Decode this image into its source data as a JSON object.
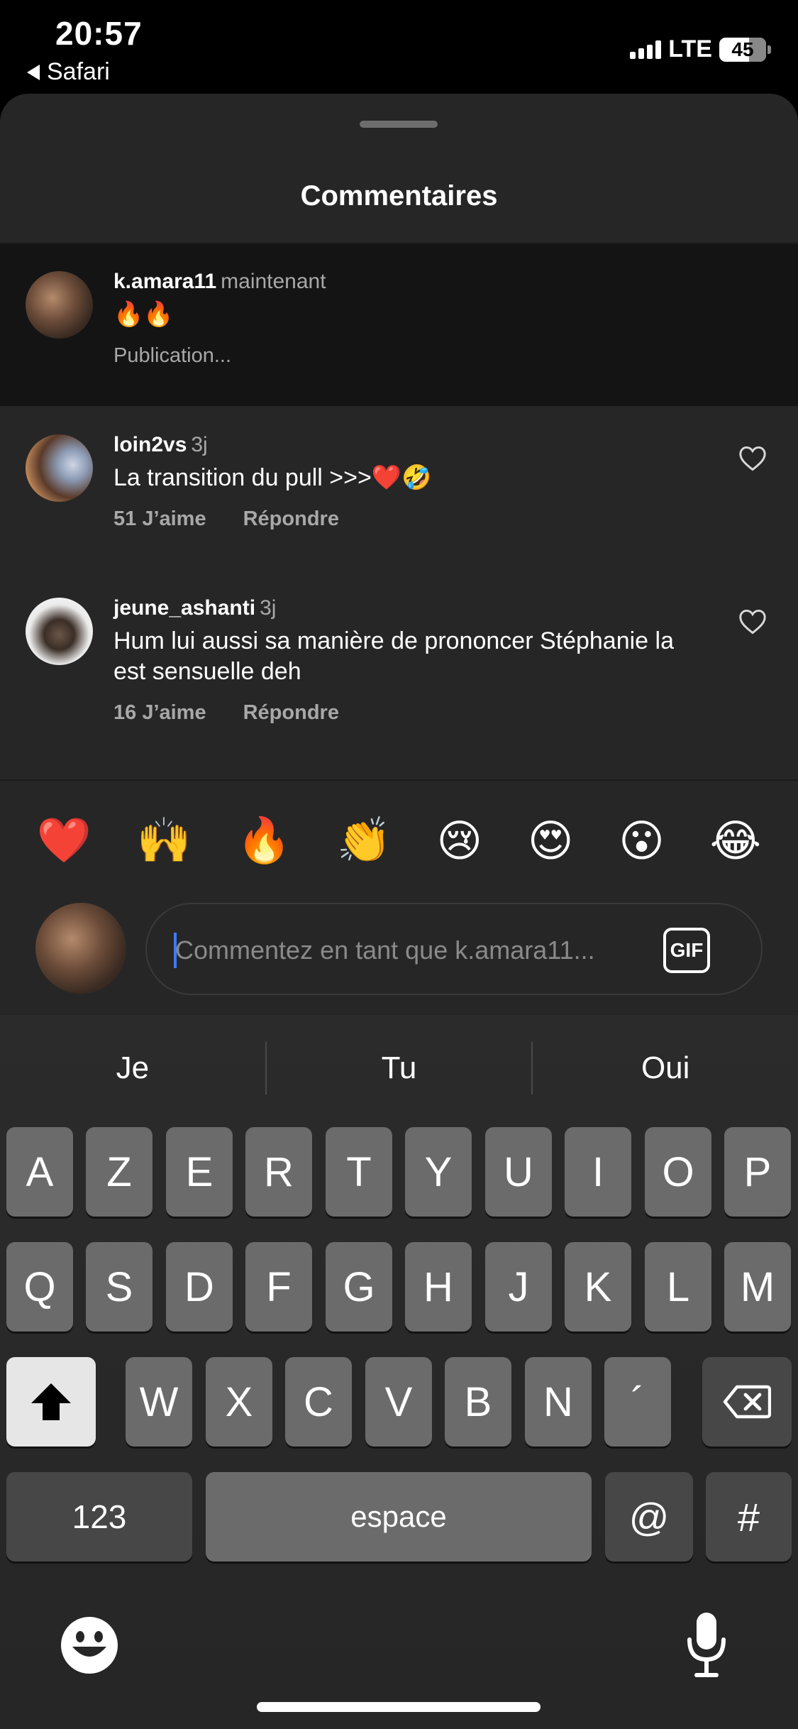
{
  "status": {
    "time": "20:57",
    "back_app": "Safari",
    "network": "LTE",
    "battery": "45"
  },
  "sheet": {
    "title": "Commentaires"
  },
  "comments": [
    {
      "user": "k.amara11",
      "time": "maintenant",
      "text": "🔥🔥",
      "status": "Publication..."
    },
    {
      "user": "loin2vs",
      "time": "3j",
      "text": "La transition du pull >>>❤️🤣",
      "likes": "51 J’aime",
      "reply": "Répondre"
    },
    {
      "user": "jeune_ashanti",
      "time": "3j",
      "text": "Hum lui aussi sa manière de prononcer Stéphanie la est sensuelle deh",
      "likes": "16 J’aime",
      "reply": "Répondre"
    }
  ],
  "quick_emojis": [
    "❤️",
    "🙌",
    "🔥",
    "👏",
    "😢",
    "😍",
    "😮",
    "😂"
  ],
  "composer": {
    "placeholder": "Commentez en tant que k.amara11...",
    "gif_label": "GIF"
  },
  "keyboard": {
    "suggestions": [
      "Je",
      "Tu",
      "Oui"
    ],
    "row1": [
      "A",
      "Z",
      "E",
      "R",
      "T",
      "Y",
      "U",
      "I",
      "O",
      "P"
    ],
    "row2": [
      "Q",
      "S",
      "D",
      "F",
      "G",
      "H",
      "J",
      "K",
      "L",
      "M"
    ],
    "row3": [
      "W",
      "X",
      "C",
      "V",
      "B",
      "N",
      "´"
    ],
    "numbers_label": "123",
    "space_label": "espace",
    "at_label": "@",
    "hash_label": "#"
  }
}
